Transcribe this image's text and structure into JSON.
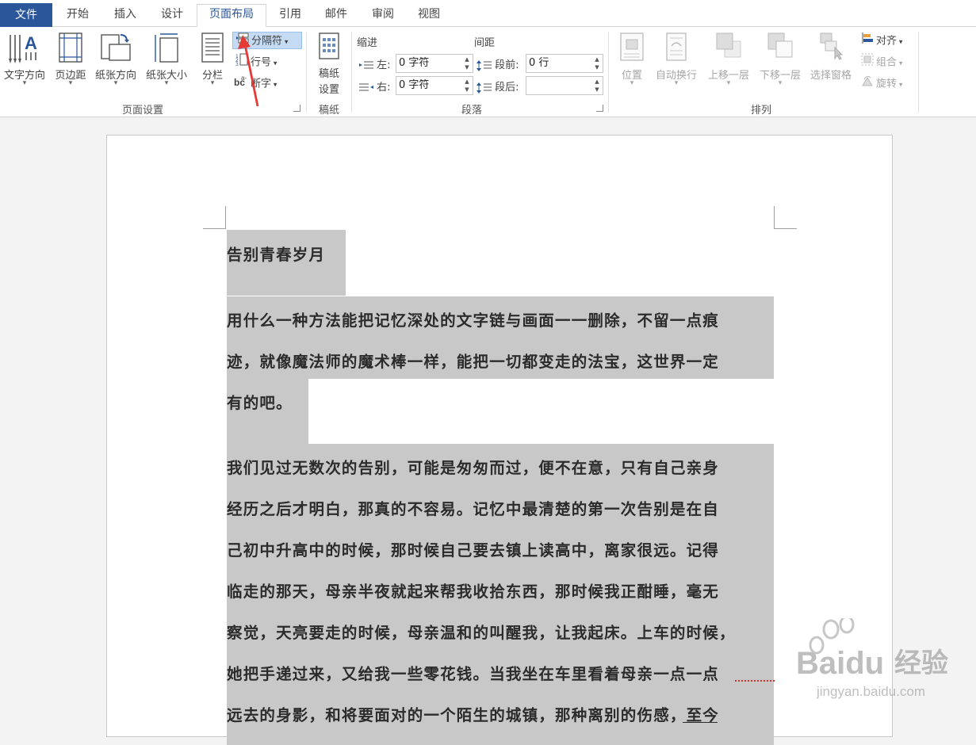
{
  "tabs": {
    "file": "文件",
    "items": [
      "开始",
      "插入",
      "设计",
      "页面布局",
      "引用",
      "邮件",
      "审阅",
      "视图"
    ],
    "active_index": 3
  },
  "ribbon": {
    "page_setup": {
      "text_direction": "文字方向",
      "margins": "页边距",
      "orientation": "纸张方向",
      "size": "纸张大小",
      "columns": "分栏",
      "breaks": "分隔符",
      "line_numbers": "行号",
      "hyphenation": "断字",
      "group_label": "页面设置"
    },
    "manuscript": {
      "button_line1": "稿纸",
      "button_line2": "设置",
      "group_label": "稿纸"
    },
    "paragraph": {
      "indent_header": "缩进",
      "spacing_header": "间距",
      "left_label": "左:",
      "right_label": "右:",
      "left_value": "0 字符",
      "right_value": "0 字符",
      "before_label": "段前:",
      "after_label": "段后:",
      "before_value": "0 行",
      "after_value": "",
      "group_label": "段落"
    },
    "arrange": {
      "position": "位置",
      "wrap_text": "自动换行",
      "bring_forward": "上移一层",
      "send_backward": "下移一层",
      "selection_pane": "选择窗格",
      "align": "对齐",
      "group": "组合",
      "rotate": "旋转",
      "group_label": "排列"
    }
  },
  "document": {
    "title": "告别青春岁月",
    "para1_lines": [
      "用什么一种方法能把记忆深处的文字链与画面一一删除，不留一点痕",
      "迹，就像魔法师的魔术棒一样，能把一切都变走的法宝，这世界一定",
      "有的吧。"
    ],
    "para2_lines": [
      "我们见过无数次的告别，可能是匆匆而过，便不在意，只有自己亲身",
      "经历之后才明白，那真的不容易。记忆中最清楚的第一次告别是在自",
      "己初中升高中的时候，那时候自己要去镇上读高中，离家很远。记得",
      "临走的那天，母亲半夜就起来帮我收拾东西，那时候我正酣睡，毫无",
      "察觉，天亮要走的时候，母亲温和的叫醒我，让我起床。上车的时候，",
      "她把手递过来，又给我一些零花钱。当我坐在车里看着母亲一点一点",
      "远去的身影，和将要面对的一个陌生的城镇，那种离别的伤感，至今"
    ]
  },
  "watermark": {
    "brand": "Baidu",
    "brand_cn": "经验",
    "url": "jingyan.baidu.com"
  },
  "colors": {
    "accent": "#2b579a",
    "selection": "#c8c8c8",
    "annotation_arrow": "#e53935"
  }
}
